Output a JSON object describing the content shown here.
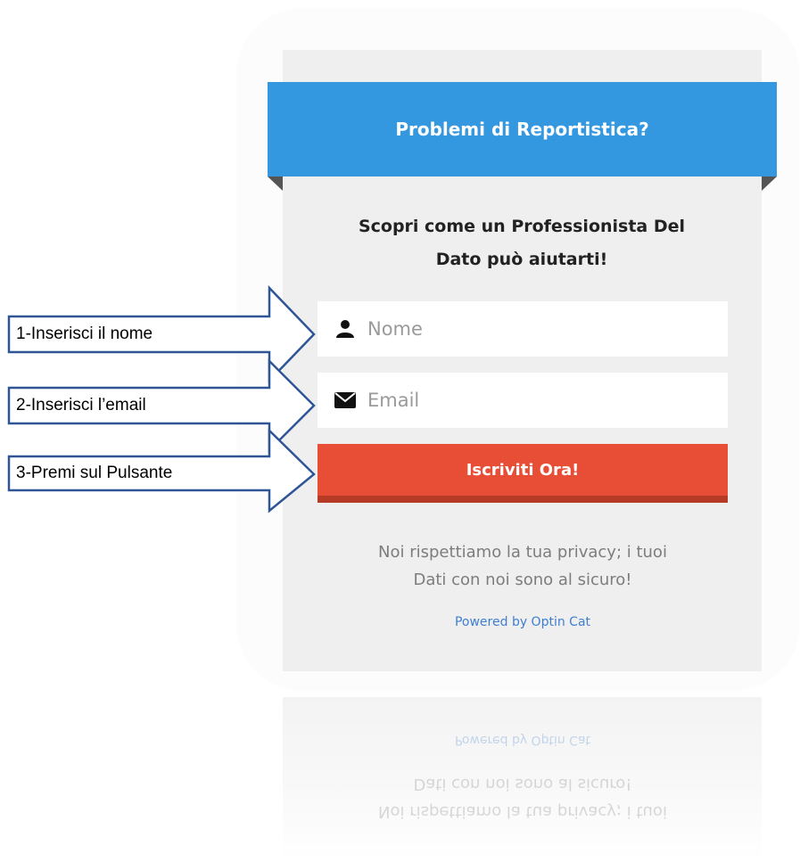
{
  "form": {
    "title": "Problemi di Reportistica?",
    "headline_line1": "Scopri come un Professionista Del",
    "headline_line2": "Dato può aiutarti!",
    "name_placeholder": "Nome",
    "email_placeholder": "Email",
    "submit_label": "Iscriviti Ora!",
    "privacy_line1": "Noi rispettiamo la tua privacy; i tuoi",
    "privacy_line2": "Dati con noi sono al sicuro!",
    "powered_by": "Powered by Optin Cat",
    "name_icon": "user-icon",
    "email_icon": "envelope-icon"
  },
  "callouts": [
    {
      "label": "1-Inserisci il nome"
    },
    {
      "label": "2-Inserisci l’email"
    },
    {
      "label": "3-Premi sul Pulsante"
    }
  ],
  "colors": {
    "ribbon": "#3498e0",
    "button": "#e84e36",
    "button_shadow": "#b63b27",
    "panel": "#efefef",
    "arrow_border": "#2f5597",
    "link": "#3f7fcf"
  }
}
